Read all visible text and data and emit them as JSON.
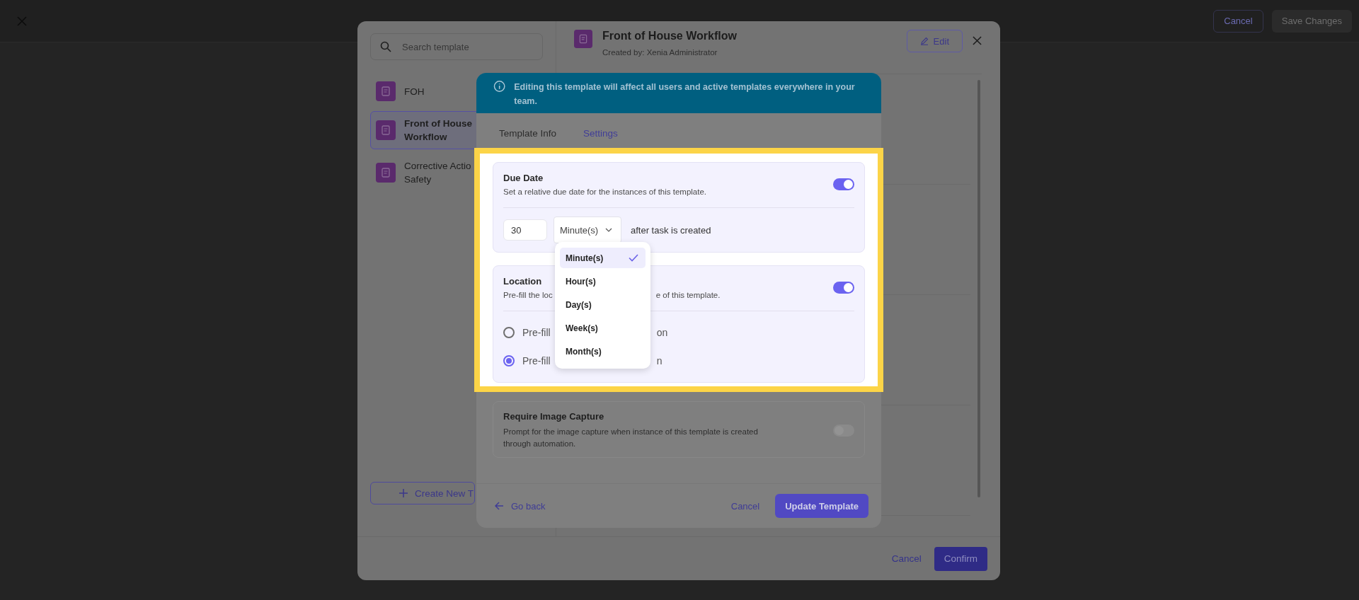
{
  "top_bar": {
    "cancel": "Cancel",
    "save": "Save Changes"
  },
  "template_list": {
    "search_placeholder": "Search template",
    "items": [
      {
        "label": "FOH",
        "selected": false
      },
      {
        "label": "Front of House Workflow",
        "selected": true
      },
      {
        "label": "Corrective Actio Safety",
        "selected": false
      }
    ],
    "create": "Create New T"
  },
  "detail": {
    "title": "Front of House Workflow",
    "created_by": "Created by: Xenia Administrator",
    "edit": "Edit"
  },
  "footer": {
    "cancel": "Cancel",
    "confirm": "Confirm"
  },
  "settings_modal": {
    "banner": "Editing this template will affect all users and active templates everywhere in your team.",
    "tabs": [
      {
        "label": "Template Info",
        "selected": false
      },
      {
        "label": "Settings",
        "selected": true
      }
    ],
    "due_date": {
      "title": "Due Date",
      "description": "Set a relative due date for the instances of this template.",
      "on": true,
      "amount": "30",
      "unit": "Minute(s)",
      "suffix": "after task is created"
    },
    "unit_menu": [
      {
        "label": "Minute(s)",
        "selected": true
      },
      {
        "label": "Hour(s)",
        "selected": false
      },
      {
        "label": "Day(s)",
        "selected": false
      },
      {
        "label": "Week(s)",
        "selected": false
      },
      {
        "label": "Month(s)",
        "selected": false
      }
    ],
    "location": {
      "title": "Location",
      "description_parts": [
        "Pre-fill the loc",
        "e of this template."
      ],
      "on": true,
      "options": [
        {
          "parts": [
            "Pre-fill",
            "on"
          ],
          "selected": false
        },
        {
          "parts": [
            "Pre-fill",
            "n"
          ],
          "selected": true
        }
      ]
    },
    "image_capture": {
      "title": "Require Image Capture",
      "description": "Prompt for the image capture when instance of this template is created through automation.",
      "on": false
    },
    "go_back": "Go back",
    "cancel": "Cancel",
    "submit": "Update Template"
  }
}
